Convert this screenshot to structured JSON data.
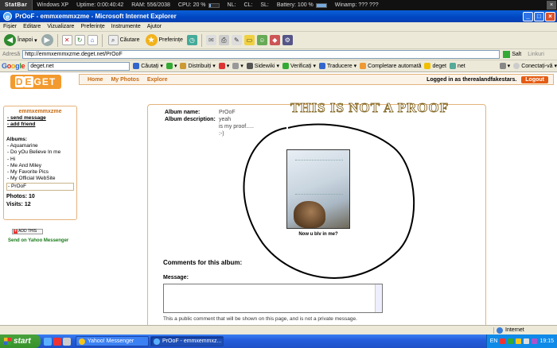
{
  "statbar": {
    "logo": "StatBar",
    "os": "Windows XP",
    "uptime": "Uptime:  0:00:40:42",
    "ram": "RAM:  556/2038",
    "cpu": "CPU:  20 %",
    "cpu_percent": 20,
    "nl": "NL:",
    "cl": "CL:",
    "sl": "SL:",
    "battery": "Battery:  100 %",
    "battery_percent": 100,
    "winamp": "Winamp:  ??? ???"
  },
  "window": {
    "title": "PrOoF - emmxemmxzme - Microsoft Internet Explorer"
  },
  "menu": [
    "Fișier",
    "Editare",
    "Vizualizare",
    "Preferințe",
    "Instrumente",
    "Ajutor"
  ],
  "toolbar": {
    "back": "Înapoi",
    "search": "Căutare",
    "favorites": "Preferințe"
  },
  "address": {
    "label": "Adresă",
    "url": "http://emmxemmxzme.deget.net/PrOoF",
    "go": "Salt",
    "links": "Linkuri"
  },
  "googlebar": {
    "search_value": "deget.net",
    "search": "Căutați",
    "share": "Distribuiți",
    "sidewiki": "Sidewiki",
    "check": "Verificați",
    "translate": "Traducere",
    "autofill": "Completare automată",
    "bookmark1": "deget",
    "bookmark2": "net",
    "signin": "Conectați-vă"
  },
  "site": {
    "logo_pre": "D",
    "logo_mid": "E",
    "logo_post": "GET",
    "nav": [
      "Home",
      "My Photos",
      "Explore"
    ],
    "logged_in": "Logged in as therealandfakestars.",
    "logout": "Logout"
  },
  "sidebar": {
    "username": "emmxemmxzme",
    "links": [
      "send message",
      "add friend"
    ],
    "albums_title": "Albums:",
    "albums": [
      "Aquamarine",
      "Do yOu Believe In me",
      "Hi",
      "Me And Miley",
      "My Favorite Pics",
      "My Official WebSite",
      "PrOoF"
    ],
    "photos": "Photos:  10",
    "visits": "Visits:  12",
    "addthis": "ADD THIS",
    "yahoo": "Send on Yahoo Messenger"
  },
  "album": {
    "name_label": "Album name:",
    "name_value": "PrOoF",
    "desc_label": "Album description:",
    "desc_lines": [
      "yeah",
      "is my proof.....",
      ":-)"
    ],
    "caption": "Now u blv in me?",
    "comments_title": "Comments for this album:",
    "message_label": "Message:",
    "message_value": "",
    "help": "This a public comment that will be shown on this page, and is not a private message."
  },
  "overlay": {
    "text": "THIS IS NOT A PROOF"
  },
  "statusbar": {
    "zone": "Internet"
  },
  "taskbar": {
    "start": "start",
    "tasks": [
      "Yahoo! Messenger",
      "PrOoF - emmxemmxz..."
    ],
    "lang": "EN",
    "clock": "19:15"
  },
  "colors": {
    "accent": "#c66a12",
    "logout": "#e45b13",
    "logo_bg": "#f39a2e",
    "border": "#e3b37b",
    "title_blue": "#0046c0",
    "start_green": "#36922c"
  }
}
